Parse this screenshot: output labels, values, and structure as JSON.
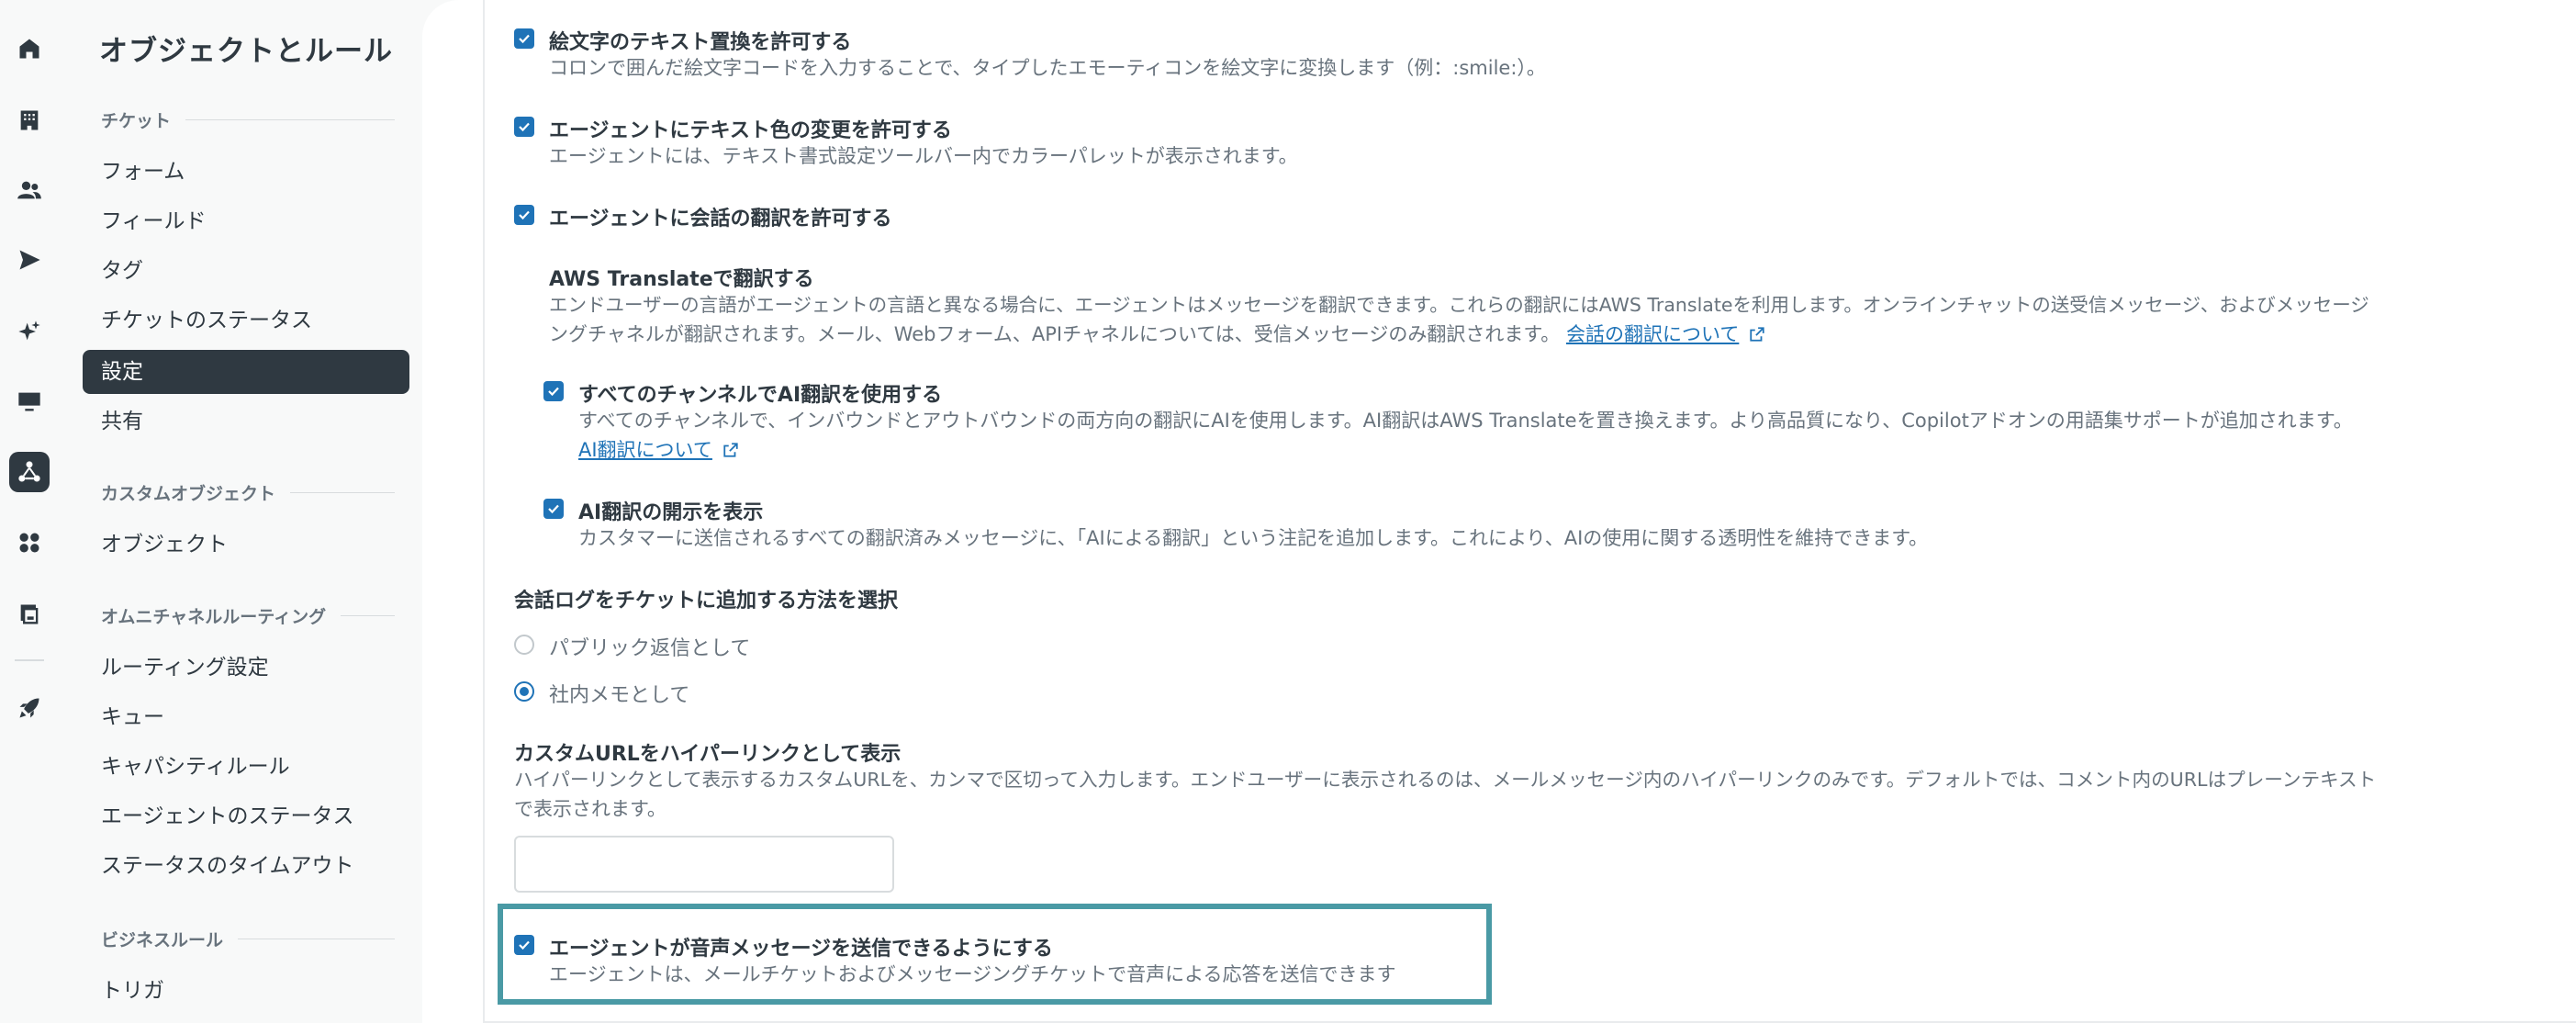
{
  "rail": {
    "icons": [
      "home-icon",
      "building-icon",
      "users-icon",
      "send-icon",
      "sparkle-icon",
      "monitor-icon",
      "objects-rules-icon",
      "apps-icon",
      "workspace-icon",
      "rocket-icon"
    ]
  },
  "nav": {
    "title": "オブジェクトとルール",
    "sections": [
      {
        "label": "チケット"
      },
      {
        "label": "カスタムオブジェクト"
      },
      {
        "label": "オムニチャネルルーティング"
      },
      {
        "label": "ビジネスルール"
      }
    ],
    "items": [
      {
        "label": "フォーム"
      },
      {
        "label": "フィールド"
      },
      {
        "label": "タグ"
      },
      {
        "label": "チケットのステータス"
      },
      {
        "label": "設定"
      },
      {
        "label": "共有"
      },
      {
        "label": "オブジェクト"
      },
      {
        "label": "ルーティング設定"
      },
      {
        "label": "キュー"
      },
      {
        "label": "キャパシティルール"
      },
      {
        "label": "エージェントのステータス"
      },
      {
        "label": "ステータスのタイムアウト"
      },
      {
        "label": "トリガ"
      }
    ]
  },
  "settings": {
    "emoji": {
      "label": "絵文字のテキスト置換を許可する",
      "desc": "コロンで囲んだ絵文字コードを入力することで、タイプしたエモーティコンを絵文字に変換します（例：:smile:）。"
    },
    "text_color": {
      "label": "エージェントにテキスト色の変更を許可する",
      "desc": "エージェントには、テキスト書式設定ツールバー内でカラーパレットが表示されます。"
    },
    "translate": {
      "label": "エージェントに会話の翻訳を許可する"
    },
    "aws": {
      "heading": "AWS Translateで翻訳する",
      "desc_line1": "エンドユーザーの言語がエージェントの言語と異なる場合に、エージェントはメッセージを翻訳できます。これらの翻訳にはAWS Translateを利用します。オンラインチャットの送受信メッセージ、およびメッセージ",
      "desc_line2": "ングチャネルが翻訳されます。メール、Webフォーム、APIチャネルについては、受信メッセージのみ翻訳されます。",
      "link": "会話の翻訳について"
    },
    "ai_all": {
      "label": "すべてのチャンネルでAI翻訳を使用する",
      "desc": "すべてのチャンネルで、インバウンドとアウトバウンドの両方向の翻訳にAIを使用します。AI翻訳はAWS Translateを置き換えます。より高品質になり、Copilotアドオンの用語集サポートが追加されます。",
      "link": "AI翻訳について"
    },
    "ai_disclosure": {
      "label": "AI翻訳の開示を表示",
      "desc": "カスタマーに送信されるすべての翻訳済みメッセージに、「AIによる翻訳」という注記を追加します。これにより、AIの使用に関する透明性を維持できます。"
    },
    "conversation_log": {
      "heading": "会話ログをチケットに追加する方法を選択",
      "options": [
        {
          "label": "パブリック返信として",
          "checked": false
        },
        {
          "label": "社内メモとして",
          "checked": true
        }
      ]
    },
    "custom_url": {
      "heading": "カスタムURLをハイパーリンクとして表示",
      "desc_line1": "ハイパーリンクとして表示するカスタムURLを、カンマで区切って入力します。エンドユーザーに表示されるのは、メールメッセージ内のハイパーリンクのみです。デフォルトでは、コメント内のURLはプレーンテキスト",
      "desc_line2": "で表示されます。",
      "value": ""
    },
    "voice": {
      "label": "エージェントが音声メッセージを送信できるようにする",
      "desc": "エージェントは、メールチケットおよびメッセージングチケットで音声による応答を送信できます"
    }
  },
  "colors": {
    "accent": "#1f73b7",
    "nav_active": "#2f3941",
    "highlight": "#4a9aa5"
  }
}
